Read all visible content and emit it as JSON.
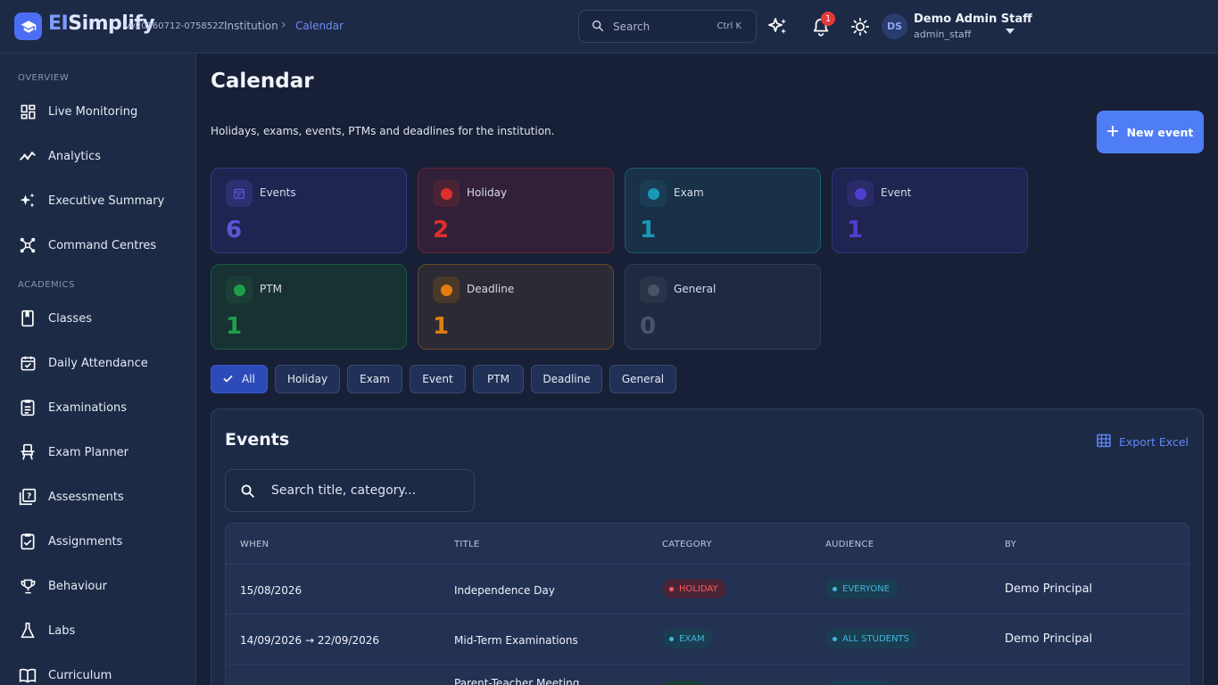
{
  "header": {
    "brand_main": "EI",
    "brand_rest": "Simplify",
    "version": "vv20260712-075852Z",
    "breadcrumb": [
      "Institution",
      "Calendar"
    ],
    "search_placeholder": "Search",
    "search_shortcut": "Ctrl K",
    "notification_count": "1",
    "user": {
      "initials": "DS",
      "name": "Demo Admin Staff",
      "role": "admin_staff"
    }
  },
  "sidebar": {
    "sections": [
      {
        "title": "OVERVIEW",
        "items": [
          "Live Monitoring",
          "Analytics",
          "Executive Summary",
          "Command Centres"
        ]
      },
      {
        "title": "ACADEMICS",
        "items": [
          "Classes",
          "Daily Attendance",
          "Examinations",
          "Exam Planner",
          "Assessments",
          "Assignments",
          "Behaviour",
          "Labs",
          "Curriculum"
        ]
      }
    ]
  },
  "page": {
    "title": "Calendar",
    "subtitle": "Holidays, exams, events, PTMs and deadlines for the institution.",
    "new_button": "New event"
  },
  "stats": [
    {
      "label": "Events",
      "value": "6",
      "color": "#5b57d9"
    },
    {
      "label": "Holiday",
      "value": "2",
      "color": "#e02d2d"
    },
    {
      "label": "Exam",
      "value": "1",
      "color": "#1a98b8"
    },
    {
      "label": "Event",
      "value": "1",
      "color": "#4f3fd0"
    },
    {
      "label": "PTM",
      "value": "1",
      "color": "#1f9e4a"
    },
    {
      "label": "Deadline",
      "value": "1",
      "color": "#e07f10"
    },
    {
      "label": "General",
      "value": "0",
      "color": "#4a5468"
    }
  ],
  "filters": {
    "items": [
      "All",
      "Holiday",
      "Exam",
      "Event",
      "PTM",
      "Deadline",
      "General"
    ],
    "selected": "All"
  },
  "events_panel": {
    "title": "Events",
    "export_label": "Export Excel",
    "search_placeholder": "Search title, category...",
    "columns": [
      "WHEN",
      "TITLE",
      "CATEGORY",
      "AUDIENCE",
      "BY"
    ],
    "rows": [
      {
        "when": "15/08/2026",
        "title": "Independence Day",
        "category": "HOLIDAY",
        "audience": "EVERYONE",
        "by": "Demo Principal"
      },
      {
        "when": "14/09/2026 → 22/09/2026",
        "title": "Mid-Term Examinations",
        "category": "EXAM",
        "audience": "ALL STUDENTS",
        "by": "Demo Principal"
      },
      {
        "when": "",
        "title": "Parent-Teacher Meeting",
        "category": "",
        "audience": "",
        "by": ""
      }
    ]
  }
}
